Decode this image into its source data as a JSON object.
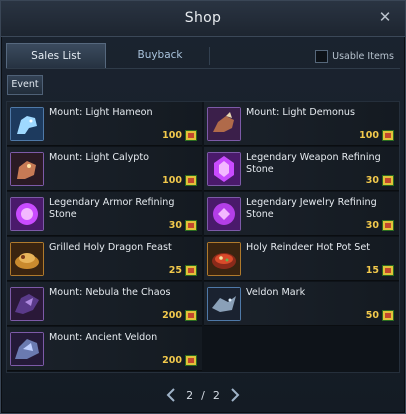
{
  "window": {
    "title": "Shop"
  },
  "tabs": [
    {
      "label": "Sales List"
    },
    {
      "label": "Buyback"
    }
  ],
  "usable_items": {
    "label": "Usable Items",
    "checked": false
  },
  "subtab": {
    "label": "Event"
  },
  "items": [
    {
      "name": "Mount: Light Hameon",
      "price": "100",
      "icon": "light-hameon-icon"
    },
    {
      "name": "Mount: Light Demonus",
      "price": "100",
      "icon": "light-demonus-icon"
    },
    {
      "name": "Mount: Light Calypto",
      "price": "100",
      "icon": "light-calypto-icon"
    },
    {
      "name": "Legendary Weapon Refining Stone",
      "price": "30",
      "icon": "weapon-refining-stone-icon"
    },
    {
      "name": "Legendary Armor Refining Stone",
      "price": "30",
      "icon": "armor-refining-stone-icon"
    },
    {
      "name": "Legendary Jewelry Refining Stone",
      "price": "30",
      "icon": "jewelry-refining-stone-icon"
    },
    {
      "name": "Grilled Holy Dragon Feast",
      "price": "25",
      "icon": "dragon-feast-icon"
    },
    {
      "name": "Holy Reindeer Hot Pot Set",
      "price": "15",
      "icon": "hot-pot-icon"
    },
    {
      "name": "Mount: Nebula the Chaos",
      "price": "200",
      "icon": "nebula-chaos-icon"
    },
    {
      "name": "Veldon Mark",
      "price": "50",
      "icon": "veldon-mark-icon"
    },
    {
      "name": "Mount: Ancient Veldon",
      "price": "200",
      "icon": "ancient-veldon-icon"
    }
  ],
  "pager": {
    "current": "2",
    "separator": "/",
    "total": "2"
  },
  "colors": {
    "price": "#f2c94c",
    "tab_text": "#a9c3dc",
    "accent_purple": "#7d5aa8"
  }
}
